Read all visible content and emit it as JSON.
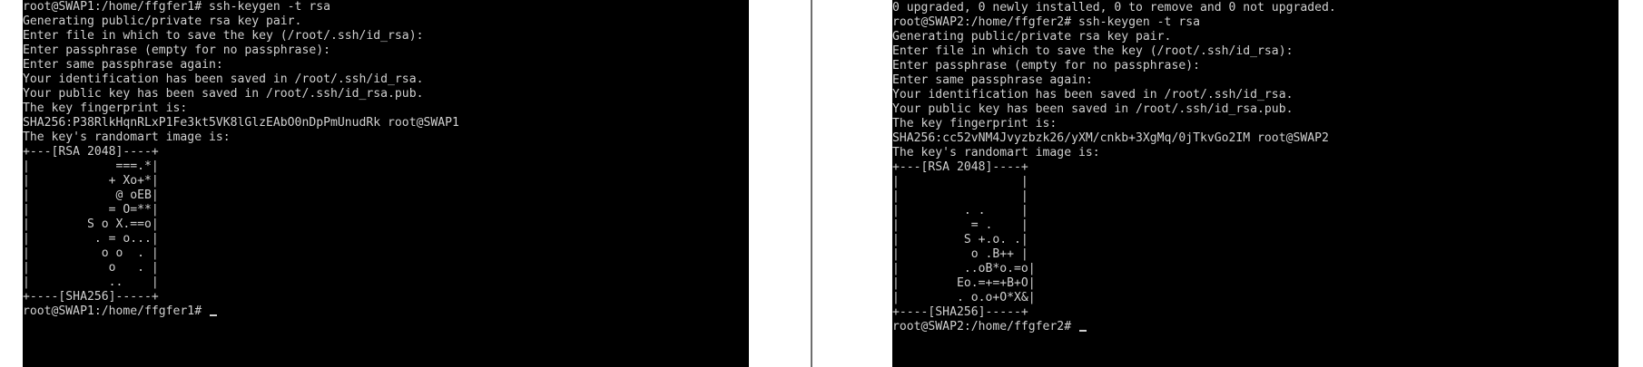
{
  "left_terminal": {
    "lines": [
      "root@SWAP1:/home/ffgfer1# ssh-keygen -t rsa",
      "Generating public/private rsa key pair.",
      "Enter file in which to save the key (/root/.ssh/id_rsa):",
      "Enter passphrase (empty for no passphrase):",
      "Enter same passphrase again:",
      "Your identification has been saved in /root/.ssh/id_rsa.",
      "Your public key has been saved in /root/.ssh/id_rsa.pub.",
      "The key fingerprint is:",
      "SHA256:P38RlkHqnRLxP1Fe3kt5VK8lGlzEAbO0nDpPmUnudRk root@SWAP1",
      "The key's randomart image is:",
      "+---[RSA 2048]----+",
      "|            ===.*|",
      "|           + Xo+*|",
      "|            @ oEB|",
      "|           = O=**|",
      "|        S o X.==o|",
      "|         . = o...|",
      "|          o o  . |",
      "|           o   . |",
      "|           ..    |",
      "+----[SHA256]-----+"
    ],
    "prompt": "root@SWAP1:/home/ffgfer1# "
  },
  "right_terminal": {
    "lines": [
      "0 upgraded, 0 newly installed, 0 to remove and 0 not upgraded.",
      "root@SWAP2:/home/ffgfer2# ssh-keygen -t rsa",
      "Generating public/private rsa key pair.",
      "Enter file in which to save the key (/root/.ssh/id_rsa):",
      "Enter passphrase (empty for no passphrase):",
      "Enter same passphrase again:",
      "Your identification has been saved in /root/.ssh/id_rsa.",
      "Your public key has been saved in /root/.ssh/id_rsa.pub.",
      "The key fingerprint is:",
      "SHA256:cc52vNM4Jvyzbzk26/yXM/cnkb+3XgMq/0jTkvGo2IM root@SWAP2",
      "The key's randomart image is:",
      "+---[RSA 2048]----+",
      "|                 |",
      "|                 |",
      "|         . .     |",
      "|          = .    |",
      "|         S +.o. .|",
      "|          o .B++ |",
      "|         ..oB*o.=o|",
      "|        Eo.=+=+B+O|",
      "|        . o.o+O*X&|",
      "+----[SHA256]-----+"
    ],
    "prompt": "root@SWAP2:/home/ffgfer2# "
  }
}
